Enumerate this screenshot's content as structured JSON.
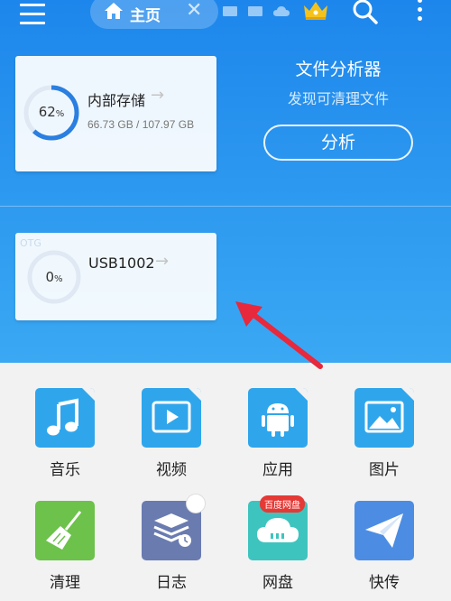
{
  "header": {
    "tab_label": "主页",
    "tab_close": "✕"
  },
  "internal_storage": {
    "percent": "62",
    "percent_sign": "%",
    "used_fraction": 0.62,
    "title": "内部存储",
    "usage": "66.73 GB / 107.97 GB"
  },
  "analyzer": {
    "title": "文件分析器",
    "subtitle": "发现可清理文件",
    "button_label": "分析"
  },
  "usb": {
    "section_label": "OTG",
    "percent": "0",
    "percent_sign": "%",
    "used_fraction": 0.0,
    "title": "USB1002"
  },
  "colors": {
    "accent_blue": "#1d86ec",
    "ring_blue": "#2a7fe0",
    "annotation_red": "#e8283c"
  },
  "grid": {
    "music": "音乐",
    "video": "视频",
    "apps": "应用",
    "pictures": "图片",
    "clean": "清理",
    "log": "日志",
    "netdisk": "网盘",
    "netdisk_badge": "百度网盘",
    "transfer": "快传"
  }
}
